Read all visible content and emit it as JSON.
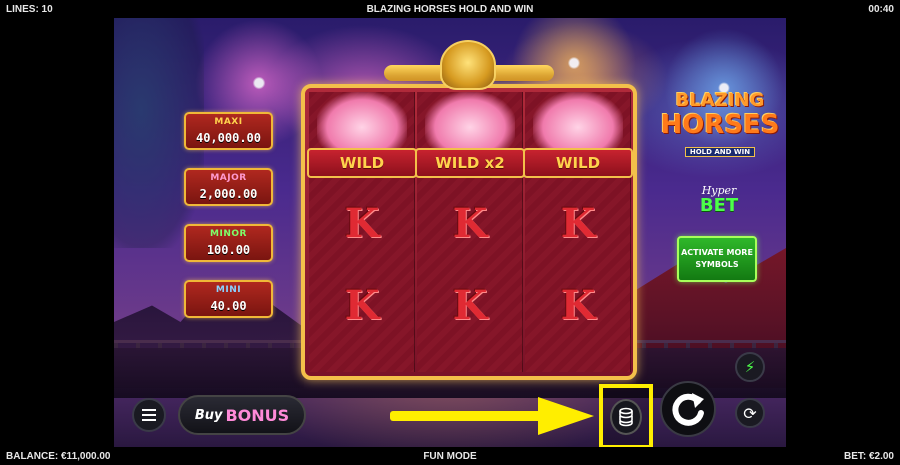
{
  "topbar": {
    "lines": "LINES: 10",
    "title": "BLAZING HORSES HOLD AND WIN",
    "time": "00:40"
  },
  "bottombar": {
    "balance": "BALANCE: €11,000.00",
    "mode": "FUN MODE",
    "bet": "BET: €2.00"
  },
  "jackpots": [
    {
      "label": "MAXI",
      "value": "40,000.00",
      "label_color": "#ffd34d"
    },
    {
      "label": "MAJOR",
      "value": "2,000.00",
      "label_color": "#ff9ad0"
    },
    {
      "label": "MINOR",
      "value": "100.00",
      "label_color": "#7dff6a"
    },
    {
      "label": "MINI",
      "value": "40.00",
      "label_color": "#8ad0ff"
    }
  ],
  "reels": {
    "wild_labels": [
      "WILD",
      "WILD x2",
      "WILD"
    ],
    "symbol": "K"
  },
  "logo": {
    "line1": "BLAZING",
    "line2": "HORSES",
    "sub": "HOLD AND WIN"
  },
  "hyperbet": {
    "hyper": "Hyper",
    "bet": "BET"
  },
  "activate_button": "ACTIVATE MORE SYMBOLS",
  "buy_bonus": {
    "buy": "Buy",
    "bonus": "BONUS"
  },
  "icons": {
    "menu": "menu-icon",
    "stack": "coin-stack-icon",
    "spin": "spin-icon",
    "turbo": "lightning-icon",
    "autoplay": "autoplay-icon",
    "arrow": "arrow-right-icon"
  },
  "colors": {
    "highlight": "#ffee00",
    "frame_gold": "#f3c04a",
    "symbol_red": "#e02a33",
    "bet_green": "#4dff4a"
  }
}
